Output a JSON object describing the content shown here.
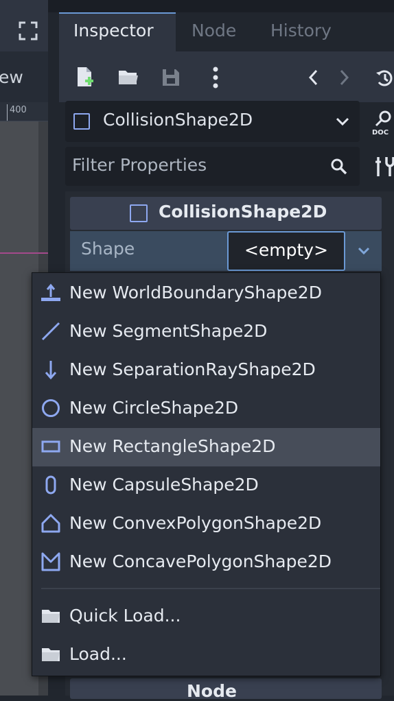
{
  "left_panel": {
    "toolbar_text": "ew",
    "ruler_label": "400"
  },
  "tabs": [
    {
      "label": "Inspector",
      "active": true
    },
    {
      "label": "Node",
      "active": false
    },
    {
      "label": "History",
      "active": false
    }
  ],
  "toolbar_icons": [
    "new-resource-icon",
    "open-folder-icon",
    "save-icon",
    "more-options-icon",
    "history-back-icon",
    "history-forward-icon",
    "object-history-icon"
  ],
  "node_selector": {
    "label": "CollisionShape2D",
    "icon": "rectangle-shape-icon"
  },
  "filter": {
    "placeholder": "Filter Properties",
    "value": ""
  },
  "inspector": {
    "section_title": "CollisionShape2D",
    "property": {
      "label": "Shape",
      "value": "<empty>"
    },
    "next_section_title": "Node"
  },
  "menu": {
    "items": [
      {
        "label": "New WorldBoundaryShape2D",
        "icon": "world-boundary-icon"
      },
      {
        "label": "New SegmentShape2D",
        "icon": "segment-icon"
      },
      {
        "label": "New SeparationRayShape2D",
        "icon": "separation-ray-icon"
      },
      {
        "label": "New CircleShape2D",
        "icon": "circle-icon"
      },
      {
        "label": "New RectangleShape2D",
        "icon": "rectangle-icon",
        "highlighted": true
      },
      {
        "label": "New CapsuleShape2D",
        "icon": "capsule-icon"
      },
      {
        "label": "New ConvexPolygonShape2D",
        "icon": "convex-polygon-icon"
      },
      {
        "label": "New ConcavePolygonShape2D",
        "icon": "concave-polygon-icon"
      }
    ],
    "load_items": [
      {
        "label": "Quick Load...",
        "icon": "folder-icon"
      },
      {
        "label": "Load...",
        "icon": "folder-icon"
      }
    ]
  },
  "colors": {
    "accent": "#6b9ad6",
    "shape_icon": "#8ea8f0",
    "panel_bg": "#21262e",
    "menu_bg": "#2b303a",
    "menu_highlight": "#474d59",
    "property_row": "#3a4b5f"
  }
}
